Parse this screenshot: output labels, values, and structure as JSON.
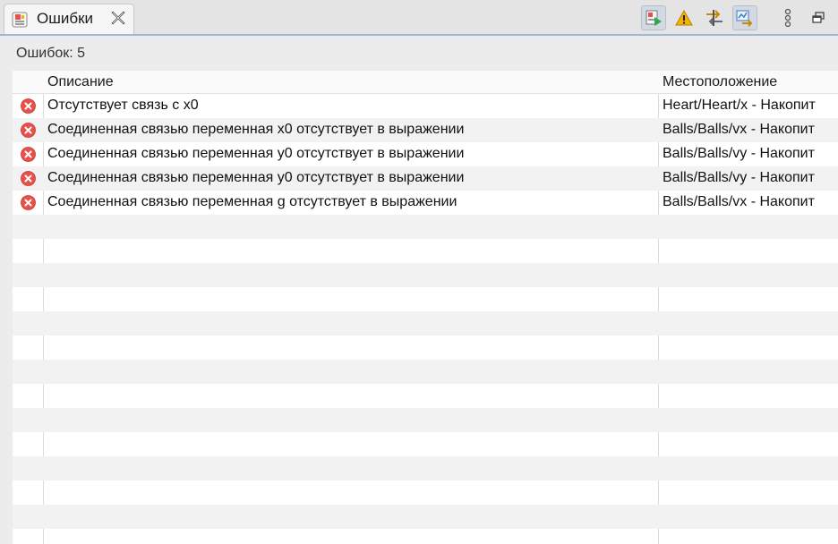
{
  "tab": {
    "title": "Ошибки",
    "icon": "problems-view-icon",
    "close_icon": "close-tab-icon"
  },
  "toolbar": {
    "buttons": [
      {
        "name": "run-check-button",
        "icon": "run-check-icon",
        "pressed": true
      },
      {
        "name": "warnings-filter-button",
        "icon": "warning-icon",
        "pressed": false
      },
      {
        "name": "connections-button",
        "icon": "connections-icon",
        "pressed": false
      },
      {
        "name": "show-source-button",
        "icon": "chart-link-icon",
        "pressed": true
      },
      {
        "name": "view-menu-button",
        "icon": "kebab-menu-icon",
        "pressed": false
      },
      {
        "name": "restore-button",
        "icon": "restore-window-icon",
        "pressed": false
      }
    ]
  },
  "summary": {
    "count_label": "Ошибок: 5"
  },
  "table": {
    "columns": {
      "description": "Описание",
      "location": "Местоположение"
    },
    "rows": [
      {
        "description": "Отсутствует связь с x0",
        "location": "Heart/Heart/x - Накопит"
      },
      {
        "description": "Соединенная связью переменная x0 отсутствует в выражении",
        "location": "Balls/Balls/vx - Накопит"
      },
      {
        "description": "Соединенная связью переменная y0 отсутствует в выражении",
        "location": "Balls/Balls/vy - Накопит"
      },
      {
        "description": "Соединенная связью переменная y0 отсутствует в выражении",
        "location": "Balls/Balls/vy - Накопит"
      },
      {
        "description": "Соединенная связью переменная g отсутствует в выражении",
        "location": "Balls/Balls/vx - Накопит"
      }
    ]
  },
  "colors": {
    "error": "#e8514a",
    "warning": "#f2b200",
    "accent": "#9fb7d4"
  }
}
